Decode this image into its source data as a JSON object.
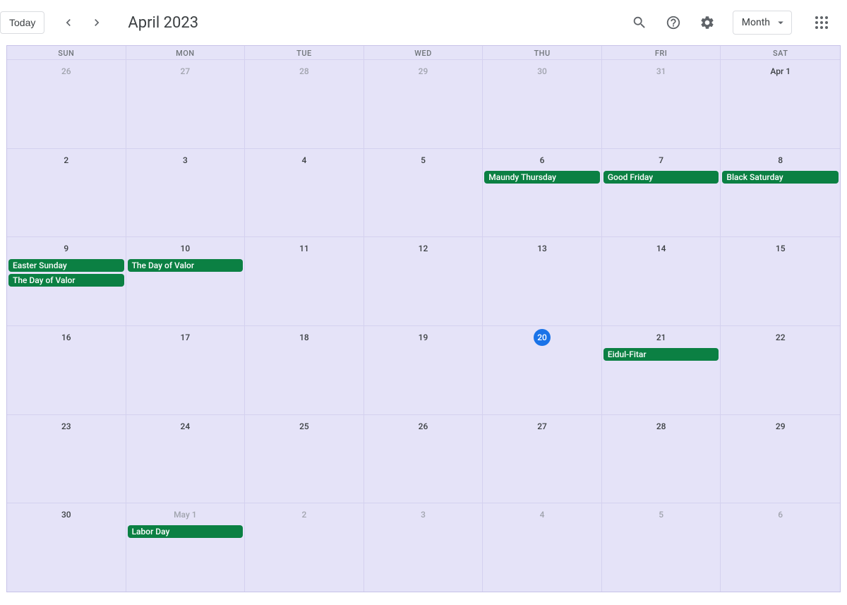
{
  "header": {
    "today_label": "Today",
    "title": "April 2023",
    "view_label": "Month"
  },
  "weekdays": [
    "SUN",
    "MON",
    "TUE",
    "WED",
    "THU",
    "FRI",
    "SAT"
  ],
  "weeks": [
    [
      {
        "num": "26",
        "other": true
      },
      {
        "num": "27",
        "other": true
      },
      {
        "num": "28",
        "other": true
      },
      {
        "num": "29",
        "other": true
      },
      {
        "num": "30",
        "other": true
      },
      {
        "num": "31",
        "other": true
      },
      {
        "num": "Apr 1",
        "monthStart": true
      }
    ],
    [
      {
        "num": "2"
      },
      {
        "num": "3"
      },
      {
        "num": "4"
      },
      {
        "num": "5"
      },
      {
        "num": "6",
        "events": [
          "Maundy Thursday"
        ]
      },
      {
        "num": "7",
        "events": [
          "Good Friday"
        ]
      },
      {
        "num": "8",
        "events": [
          "Black Saturday"
        ]
      }
    ],
    [
      {
        "num": "9",
        "events": [
          "Easter Sunday",
          "The Day of Valor"
        ]
      },
      {
        "num": "10",
        "events": [
          "The Day of Valor"
        ]
      },
      {
        "num": "11"
      },
      {
        "num": "12"
      },
      {
        "num": "13"
      },
      {
        "num": "14"
      },
      {
        "num": "15"
      }
    ],
    [
      {
        "num": "16"
      },
      {
        "num": "17"
      },
      {
        "num": "18"
      },
      {
        "num": "19"
      },
      {
        "num": "20",
        "today": true
      },
      {
        "num": "21",
        "events": [
          "Eidul-Fitar"
        ]
      },
      {
        "num": "22"
      }
    ],
    [
      {
        "num": "23"
      },
      {
        "num": "24"
      },
      {
        "num": "25"
      },
      {
        "num": "26"
      },
      {
        "num": "27"
      },
      {
        "num": "28"
      },
      {
        "num": "29"
      }
    ],
    [
      {
        "num": "30"
      },
      {
        "num": "May 1",
        "other": true,
        "monthStart": true,
        "events": [
          "Labor Day"
        ]
      },
      {
        "num": "2",
        "other": true
      },
      {
        "num": "3",
        "other": true
      },
      {
        "num": "4",
        "other": true
      },
      {
        "num": "5",
        "other": true
      },
      {
        "num": "6",
        "other": true
      }
    ]
  ]
}
